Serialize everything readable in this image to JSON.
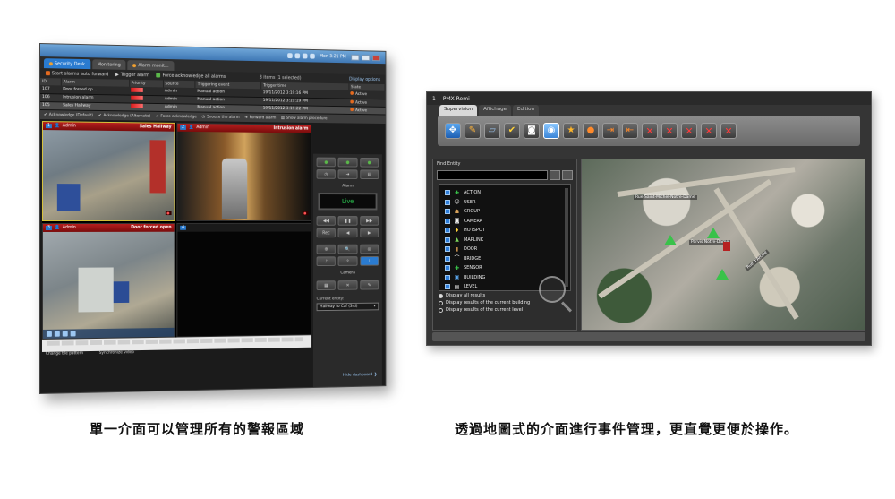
{
  "left": {
    "taskbar": {
      "clock": "Mon 3:21 PM"
    },
    "tabs": [
      {
        "label": "Security Desk"
      },
      {
        "label": "Monitoring"
      },
      {
        "label": "Alarm monit..."
      }
    ],
    "alarm_toolbar": {
      "start_auto_forward": "Start alarms auto forward",
      "trigger_alarm": "Trigger alarm",
      "force_ack_all": "Force acknowledge all alarms",
      "items_selected": "3 items (1 selected)",
      "display_options": "Display options"
    },
    "table": {
      "headers": [
        "ID",
        "Alarm",
        "Priority",
        "Source",
        "Triggering event",
        "Trigger time",
        "State"
      ],
      "rows": [
        {
          "id": "107",
          "alarm": "Door forced op...",
          "source": "Admin",
          "event": "Manual action",
          "time": "19/11/2012 3:19:16 PM",
          "state": "Active"
        },
        {
          "id": "106",
          "alarm": "Intrusion alarm",
          "source": "Admin",
          "event": "Manual action",
          "time": "19/11/2012 3:19:19 PM",
          "state": "Active"
        },
        {
          "id": "105",
          "alarm": "Sales Hallway",
          "source": "Admin",
          "event": "Manual action",
          "time": "19/11/2012 3:19:22 PM",
          "state": "Active"
        }
      ]
    },
    "ack_bar": {
      "ack_default": "Acknowledge (Default)",
      "ack_alternate": "Acknowledge (Alternate)",
      "force_ack": "Force acknowledge",
      "snooze": "Snooze the alarm",
      "forward": "Forward alarm",
      "procedure": "Show alarm procedure"
    },
    "tiles": [
      {
        "num": "1",
        "user": "Admin",
        "title": "Sales Hallway"
      },
      {
        "num": "2",
        "user": "Admin",
        "title": "Intrusion alarm"
      },
      {
        "num": "3",
        "user": "Admin",
        "title": "Door forced open"
      },
      {
        "num": "4",
        "user": "",
        "title": ""
      }
    ],
    "side_panel": {
      "alarm_label": "Alarm",
      "live_label": "Live",
      "rec_label": "Rec",
      "camera_label": "Camera",
      "current_entity_label": "Current entity:",
      "current_entity_value": "Hallway to Caf (3rd)"
    },
    "bottom": {
      "change_pattern": "Change tile pattern",
      "sync_video": "Synchronize video",
      "hide_dashboard": "Hide dashboard"
    }
  },
  "right": {
    "title_num": "1",
    "title": "PMX Remi",
    "tabs": [
      {
        "label": "Supervision"
      },
      {
        "label": "Affichage"
      },
      {
        "label": "Edition"
      }
    ],
    "find_entity": {
      "header": "Find Entity",
      "items": [
        {
          "label": "ACTION",
          "icon": "action-icon"
        },
        {
          "label": "USER",
          "icon": "user-icon"
        },
        {
          "label": "GROUP",
          "icon": "group-icon"
        },
        {
          "label": "CAMERA",
          "icon": "camera-icon"
        },
        {
          "label": "HOTSPOT",
          "icon": "hotspot-icon"
        },
        {
          "label": "MAPLINK",
          "icon": "maplink-icon"
        },
        {
          "label": "DOOR",
          "icon": "door-icon"
        },
        {
          "label": "BRIDGE",
          "icon": "bridge-icon"
        },
        {
          "label": "SENSOR",
          "icon": "sensor-icon"
        },
        {
          "label": "BUILDING",
          "icon": "building-icon"
        },
        {
          "label": "LEVEL",
          "icon": "level-icon"
        }
      ],
      "radios": [
        {
          "label": "Display all results",
          "selected": true
        },
        {
          "label": "Display results of the current building",
          "selected": false
        },
        {
          "label": "Display results of the current level",
          "selected": false
        }
      ]
    },
    "map": {
      "labels": [
        "Rue Saint-Michel-Notre-Dame",
        "Parvis Notre-Dame",
        "Rue d'Arcole"
      ]
    }
  },
  "captions": {
    "left": "單一介面可以管理所有的警報區域",
    "right": "透過地圖式的介面進行事件管理，更直覺更便於操作。"
  }
}
